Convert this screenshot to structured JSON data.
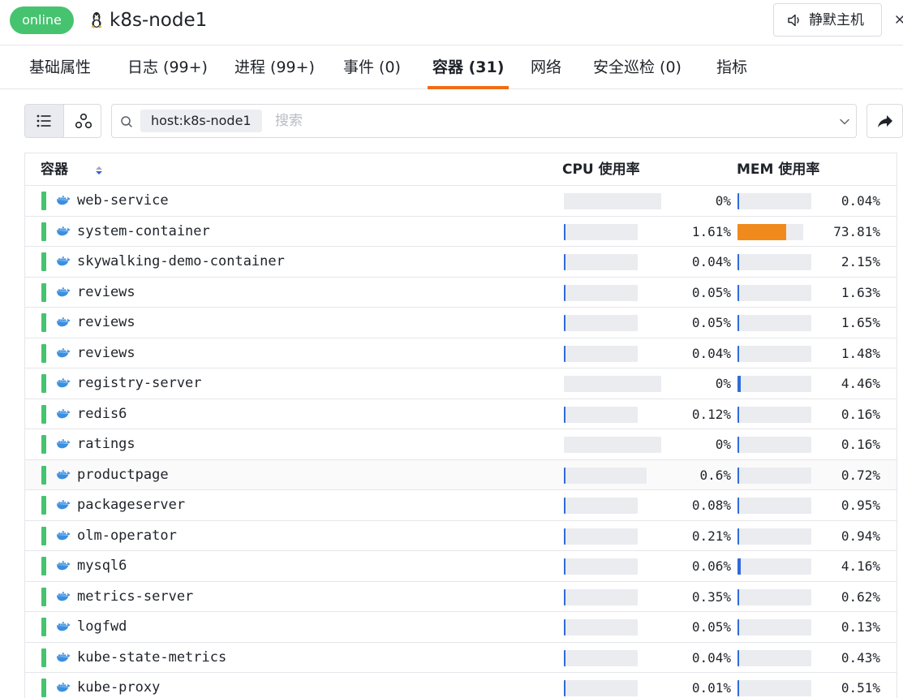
{
  "header": {
    "status_badge": "online",
    "host_name": "k8s-node1",
    "mute_button_label": "静默主机"
  },
  "tabs": [
    {
      "label": "基础属性",
      "active": false
    },
    {
      "label": "日志 (99+)",
      "active": false
    },
    {
      "label": "进程 (99+)",
      "active": false
    },
    {
      "label": "事件 (0)",
      "active": false
    },
    {
      "label": "容器 (31)",
      "active": true
    },
    {
      "label": "网络",
      "active": false
    },
    {
      "label": "安全巡检 (0)",
      "active": false
    },
    {
      "label": "指标",
      "active": false
    }
  ],
  "search": {
    "tag": "host:k8s-node1",
    "placeholder": "搜索"
  },
  "table": {
    "columns": {
      "name": "容器",
      "cpu": "CPU 使用率",
      "mem": "MEM 使用率"
    },
    "rows": [
      {
        "name": "web-service",
        "cpu": 0,
        "cpu_label": "0%",
        "mem": 0.04,
        "mem_label": "0.04%"
      },
      {
        "name": "system-container",
        "cpu": 1.61,
        "cpu_label": "1.61%",
        "mem": 73.81,
        "mem_label": "73.81%"
      },
      {
        "name": "skywalking-demo-container",
        "cpu": 0.04,
        "cpu_label": "0.04%",
        "mem": 2.15,
        "mem_label": "2.15%"
      },
      {
        "name": "reviews",
        "cpu": 0.05,
        "cpu_label": "0.05%",
        "mem": 1.63,
        "mem_label": "1.63%"
      },
      {
        "name": "reviews",
        "cpu": 0.05,
        "cpu_label": "0.05%",
        "mem": 1.65,
        "mem_label": "1.65%"
      },
      {
        "name": "reviews",
        "cpu": 0.04,
        "cpu_label": "0.04%",
        "mem": 1.48,
        "mem_label": "1.48%"
      },
      {
        "name": "registry-server",
        "cpu": 0,
        "cpu_label": "0%",
        "mem": 4.46,
        "mem_label": "4.46%"
      },
      {
        "name": "redis6",
        "cpu": 0.12,
        "cpu_label": "0.12%",
        "mem": 0.16,
        "mem_label": "0.16%"
      },
      {
        "name": "ratings",
        "cpu": 0,
        "cpu_label": "0%",
        "mem": 0.16,
        "mem_label": "0.16%"
      },
      {
        "name": "productpage",
        "cpu": 0.6,
        "cpu_label": "0.6%",
        "mem": 0.72,
        "mem_label": "0.72%"
      },
      {
        "name": "packageserver",
        "cpu": 0.08,
        "cpu_label": "0.08%",
        "mem": 0.95,
        "mem_label": "0.95%"
      },
      {
        "name": "olm-operator",
        "cpu": 0.21,
        "cpu_label": "0.21%",
        "mem": 0.94,
        "mem_label": "0.94%"
      },
      {
        "name": "mysql6",
        "cpu": 0.06,
        "cpu_label": "0.06%",
        "mem": 4.16,
        "mem_label": "4.16%"
      },
      {
        "name": "metrics-server",
        "cpu": 0.35,
        "cpu_label": "0.35%",
        "mem": 0.62,
        "mem_label": "0.62%"
      },
      {
        "name": "logfwd",
        "cpu": 0.05,
        "cpu_label": "0.05%",
        "mem": 0.13,
        "mem_label": "0.13%"
      },
      {
        "name": "kube-state-metrics",
        "cpu": 0.04,
        "cpu_label": "0.04%",
        "mem": 0.43,
        "mem_label": "0.43%"
      },
      {
        "name": "kube-proxy",
        "cpu": 0.01,
        "cpu_label": "0.01%",
        "mem": 0.51,
        "mem_label": "0.51%"
      }
    ]
  },
  "colors": {
    "online": "#46c36f",
    "active_tab_underline": "#ef6c16",
    "bar_normal": "#2f6bd8",
    "bar_high": "#f08a1c",
    "bar_track": "#ebecf0"
  },
  "icons": [
    "linux-icon",
    "speaker-icon",
    "list-view-icon",
    "topology-view-icon",
    "search-icon",
    "chevron-down-icon",
    "share-icon",
    "sort-icon",
    "docker-icon"
  ]
}
